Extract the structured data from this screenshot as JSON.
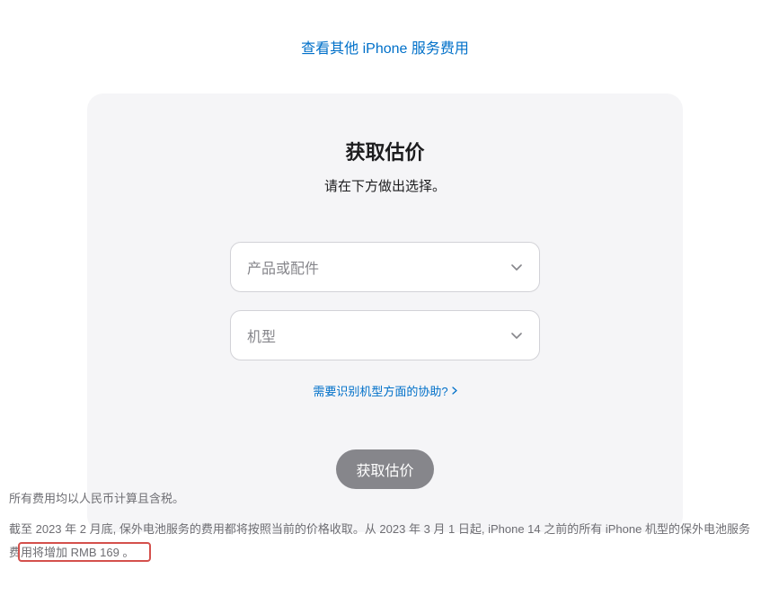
{
  "header": {
    "other_services_link": "查看其他 iPhone 服务费用"
  },
  "card": {
    "title": "获取估价",
    "subtitle": "请在下方做出选择。",
    "select1_placeholder": "产品或配件",
    "select2_placeholder": "机型",
    "help_link": "需要识别机型方面的协助?",
    "button_label": "获取估价"
  },
  "footnotes": {
    "line1": "所有费用均以人民币计算且含税。",
    "line2": "截至 2023 年 2 月底, 保外电池服务的费用都将按照当前的价格收取。从 2023 年 3 月 1 日起, iPhone 14 之前的所有 iPhone 机型的保外电池服务费用将增加 RMB 169 。"
  }
}
